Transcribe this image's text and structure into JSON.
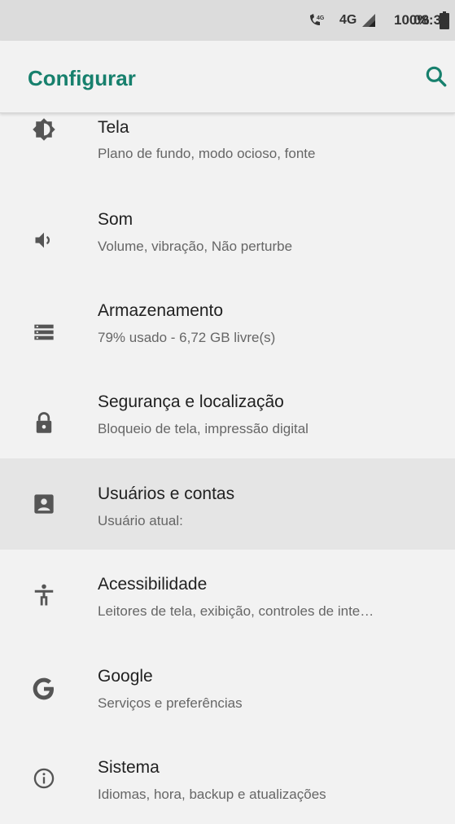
{
  "status_bar": {
    "volte": "4G",
    "network": "4G",
    "battery_percent": "100%",
    "time": "08:32"
  },
  "app_bar": {
    "title": "Configurar",
    "search_icon": "search-icon"
  },
  "settings": [
    {
      "icon": "brightness-icon",
      "title": "Tela",
      "subtitle": "Plano de fundo, modo ocioso, fonte"
    },
    {
      "icon": "volume-icon",
      "title": "Som",
      "subtitle": "Volume, vibração, Não perturbe"
    },
    {
      "icon": "storage-icon",
      "title": "Armazenamento",
      "subtitle": "79% usado - 6,72 GB livre(s)"
    },
    {
      "icon": "lock-icon",
      "title": "Segurança e localização",
      "subtitle": "Bloqueio de tela, impressão digital"
    },
    {
      "icon": "account-box-icon",
      "title": "Usuários e contas",
      "subtitle": "Usuário atual:"
    },
    {
      "icon": "accessibility-icon",
      "title": "Acessibilidade",
      "subtitle": "Leitores de tela, exibição, controles de inte…"
    },
    {
      "icon": "google-icon",
      "title": "Google",
      "subtitle": "Serviços e preferências"
    },
    {
      "icon": "info-icon",
      "title": "Sistema",
      "subtitle": "Idiomas, hora, backup e atualizações"
    }
  ],
  "colors": {
    "accent": "#17806d",
    "icon": "#555555",
    "highlight_row": "#e5e5e5"
  }
}
